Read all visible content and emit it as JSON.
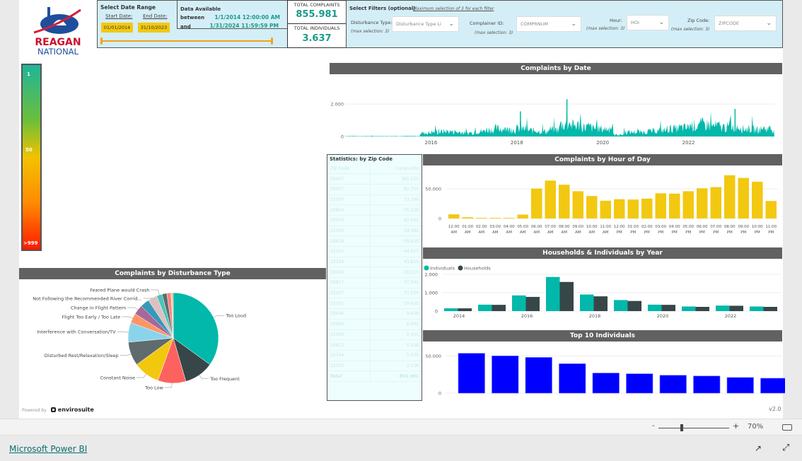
{
  "logo": {
    "line1": "REAGAN",
    "line2": "NATIONAL"
  },
  "date_range": {
    "title": "Select Date Range",
    "start_label": "Start Date:",
    "end_label": "End Date:",
    "start": "01/01/2014",
    "end": "31/10/2023"
  },
  "data_available": {
    "title": "Data Available",
    "between": "between",
    "and": "and",
    "from": "1/1/2014 12:00:00 AM",
    "to": "1/31/2024 11:59:59 PM"
  },
  "totals": {
    "complaints_label": "TOTAL COMPLAINTS",
    "complaints": "855.981",
    "individuals_label": "TOTAL INDIVIDUALS",
    "individuals": "3.637"
  },
  "filters": {
    "title": "Select Filters (optional)",
    "note": "Maximum selection of 3 for each filter",
    "max": "(max selection: 3)",
    "items": [
      {
        "label": "Disturbance Type:",
        "value": "Disturbance Type Li"
      },
      {
        "label": "Complainer ID:",
        "value": "COMPRNUM"
      },
      {
        "label": "Hour:",
        "value": "HOI"
      },
      {
        "label": "Zip Code:",
        "value": "ZIPCODE"
      }
    ]
  },
  "color_scale": {
    "top": "1",
    "mid": "50",
    "bottom": ">999",
    "colors": [
      "#1fb59a",
      "#6cbf3a",
      "#f2c200",
      "#ff8a00",
      "#ff1a00"
    ]
  },
  "stats": {
    "title": "Statistics: by Zip Code",
    "headers": [
      "Zip Code",
      "Complaints"
    ],
    "rows": [
      [
        "20607",
        "161.510"
      ],
      [
        "20007",
        "82.714"
      ],
      [
        "22307",
        "73.249"
      ],
      [
        "20854",
        "70.226"
      ],
      [
        "20016",
        "62.161"
      ],
      [
        "22306",
        "59.582"
      ],
      [
        "20818",
        "58.650"
      ],
      [
        "22101",
        "44.617"
      ],
      [
        "22314",
        "43.814"
      ],
      [
        "20816",
        "39.513"
      ],
      [
        "20817",
        "37.542"
      ],
      [
        "22207",
        "37.154"
      ],
      [
        "22201",
        "10.415"
      ],
      [
        "20646",
        "9.626"
      ],
      [
        "20650",
        "6.581"
      ],
      [
        "22066",
        "5.451"
      ],
      [
        "20812",
        "5.038"
      ],
      [
        "20744",
        "5.029"
      ],
      [
        "22153",
        "3.106"
      ]
    ],
    "total_label": "Total",
    "total": "855.981"
  },
  "powered_by": "Powered by",
  "brand": "envirosuite",
  "version": "v2.0",
  "zoom": {
    "minus": "-",
    "plus": "+",
    "level": "70%"
  },
  "footer": {
    "link": "Microsoft Power BI"
  },
  "chart_data": [
    {
      "type": "area",
      "title": "Complaints by Date",
      "x": [
        "2014-01",
        "2014-04",
        "2014-07",
        "2014-10",
        "2015-01",
        "2015-04",
        "2015-07",
        "2015-10",
        "2016-01",
        "2016-04",
        "2016-07",
        "2016-10",
        "2017-01",
        "2017-04",
        "2017-07",
        "2017-10",
        "2018-01",
        "2018-04",
        "2018-07",
        "2018-10",
        "2019-01",
        "2019-04",
        "2019-07",
        "2019-10",
        "2020-01",
        "2020-04",
        "2020-07",
        "2020-10",
        "2021-01",
        "2021-04",
        "2021-07",
        "2021-10",
        "2022-01",
        "2022-04",
        "2022-07",
        "2022-10",
        "2023-01",
        "2023-04",
        "2023-07",
        "2023-10"
      ],
      "y": [
        20,
        20,
        20,
        20,
        20,
        20,
        20,
        200,
        250,
        300,
        250,
        200,
        300,
        400,
        450,
        400,
        450,
        350,
        300,
        400,
        700,
        650,
        550,
        450,
        450,
        100,
        250,
        250,
        300,
        350,
        450,
        500,
        650,
        700,
        600,
        550,
        600,
        450,
        400,
        450
      ],
      "peaks": [
        {
          "x": "2018-02",
          "y": 1550
        },
        {
          "x": "2019-03",
          "y": 2300
        },
        {
          "x": "2023-02",
          "y": 1700
        }
      ],
      "yticks": [
        "0",
        "2.000"
      ],
      "ytick_values": [
        0,
        2000
      ],
      "xticks": [
        "2016",
        "2018",
        "2020",
        "2022"
      ],
      "ylim": [
        0,
        2400
      ],
      "color": "#01b8aa",
      "grid": true
    },
    {
      "type": "bar",
      "title": "Complaints by Hour of Day",
      "categories": [
        "12:00 AM",
        "01:00 AM",
        "02:00 AM",
        "03:00 AM",
        "04:00 AM",
        "05:00 AM",
        "06:00 AM",
        "07:00 AM",
        "08:00 AM",
        "09:00 AM",
        "10:00 AM",
        "11:00 AM",
        "12:00 PM",
        "01:00 PM",
        "02:00 PM",
        "03:00 PM",
        "04:00 PM",
        "05:00 PM",
        "06:00 PM",
        "07:00 PM",
        "08:00 PM",
        "09:00 PM",
        "10:00 PM",
        "11:00 PM"
      ],
      "values": [
        7000,
        2000,
        1000,
        1000,
        1000,
        6500,
        50500,
        64000,
        57000,
        46000,
        38000,
        30000,
        32500,
        32000,
        33500,
        42500,
        42000,
        46000,
        51000,
        53000,
        73000,
        68500,
        62000,
        29500
      ],
      "yticks": [
        "0",
        "50.000"
      ],
      "ytick_values": [
        0,
        50000
      ],
      "ylim": [
        0,
        80000
      ],
      "color": "#f2c811"
    },
    {
      "type": "bar",
      "title": "Households & Individuals by Year",
      "categories": [
        "2014",
        "2015",
        "2016",
        "2017",
        "2018",
        "2019",
        "2020",
        "2021",
        "2022",
        "2023"
      ],
      "xticks": [
        "2014",
        "2016",
        "2018",
        "2020",
        "2022"
      ],
      "series": [
        {
          "name": "Individuals",
          "color": "#01b8aa",
          "values": [
            150,
            350,
            850,
            1850,
            900,
            600,
            350,
            250,
            300,
            250
          ]
        },
        {
          "name": "Households",
          "color": "#374649",
          "values": [
            150,
            340,
            770,
            1580,
            800,
            550,
            340,
            230,
            290,
            230
          ]
        }
      ],
      "yticks": [
        "0",
        "1.000",
        "2.000"
      ],
      "ytick_values": [
        0,
        1000,
        2000
      ],
      "ylim": [
        0,
        2300
      ],
      "legend": "top-left"
    },
    {
      "type": "bar",
      "title": "Top 10  Individuals",
      "values": [
        53500,
        50000,
        48000,
        39500,
        27000,
        26000,
        24000,
        23000,
        21000,
        20000
      ],
      "yticks": [
        "0",
        "50.000"
      ],
      "ytick_values": [
        0,
        50000
      ],
      "ylim": [
        0,
        57000
      ],
      "color": "#0000ff"
    },
    {
      "type": "pie",
      "title": "Complaints by Disturbance Type",
      "slices": [
        {
          "label": "Too Loud",
          "value": 35,
          "color": "#01b8aa"
        },
        {
          "label": "Too Frequent",
          "value": 10.5,
          "color": "#374649"
        },
        {
          "label": "Too Low",
          "value": 10,
          "color": "#fd625e"
        },
        {
          "label": "Constant Noise",
          "value": 9.5,
          "color": "#f2c80f"
        },
        {
          "label": "Disturbed Rest/Relaxation/Sleep",
          "value": 8.5,
          "color": "#5f6b6d"
        },
        {
          "label": "Interference with Conversation/TV",
          "value": 7,
          "color": "#8ad4eb"
        },
        {
          "label": "Flight Too Early / Too Late",
          "value": 3.5,
          "color": "#fe9666"
        },
        {
          "label": "Change in Flight Pattern",
          "value": 3.5,
          "color": "#a66999"
        },
        {
          "label": "",
          "value": 3.2,
          "color": "#3599b8"
        },
        {
          "label": "Not Following the Recommended River Corrid...",
          "value": 3.3,
          "color": "#dfbfbf"
        },
        {
          "label": "Feared Plane would Crash",
          "value": 2,
          "color": "#4ac5bb"
        },
        {
          "label": "",
          "value": 1.7,
          "color": "#5f6b6d"
        },
        {
          "label": "",
          "value": 1.5,
          "color": "#fb8281"
        },
        {
          "label": "",
          "value": 0.5,
          "color": "#f4d25a"
        },
        {
          "label": "",
          "value": 0.3,
          "color": "#7f898a"
        }
      ]
    }
  ]
}
